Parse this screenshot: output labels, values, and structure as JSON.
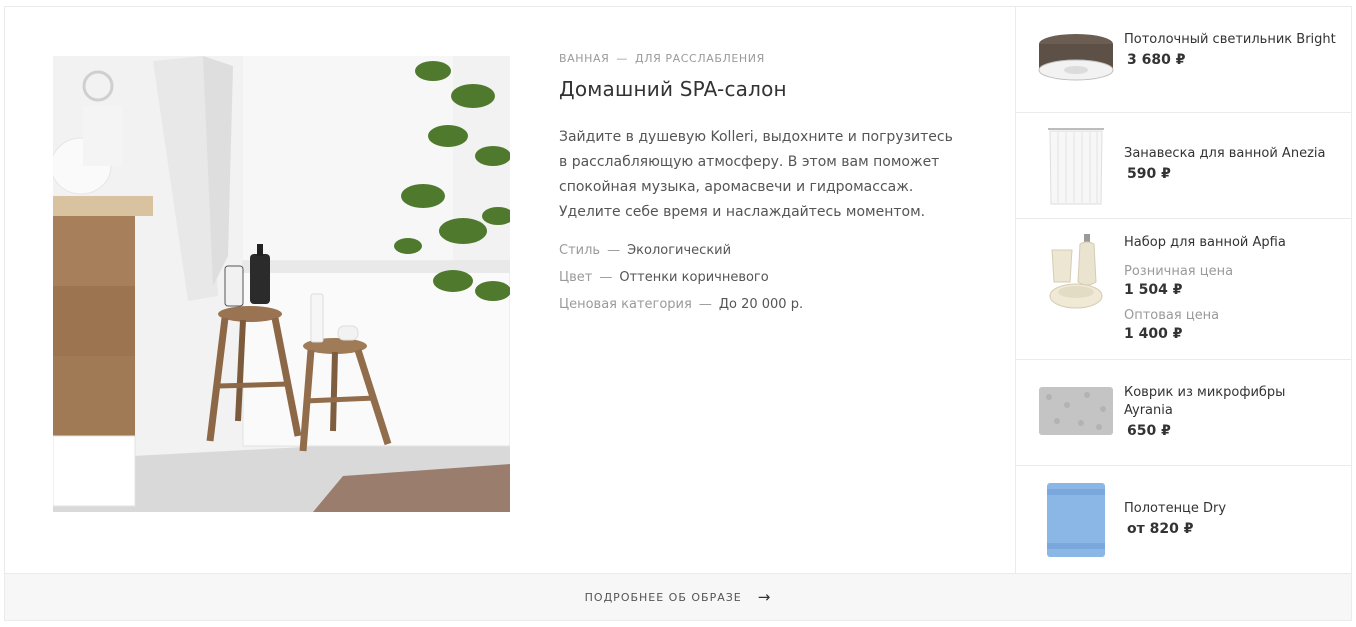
{
  "look": {
    "breadcrumbs": [
      "ВАННАЯ",
      "ДЛЯ РАССЛАБЛЕНИЯ"
    ],
    "separator": "—",
    "title": "Домашний SPA-салон",
    "description": "Зайдите в душевую Kolleri, выдохните и погрузитесь в расслабляющую атмосферу. В этом вам поможет спокойная музыка, аромасвечи и гидромассаж. Уделите себе время и наслаждайтесь моментом.",
    "properties": [
      {
        "label": "Стиль",
        "value": "Экологический"
      },
      {
        "label": "Цвет",
        "value": "Оттенки коричневого"
      },
      {
        "label": "Ценовая категория",
        "value": "До 20 000 р."
      }
    ]
  },
  "products": [
    {
      "name": "Потолочный светильник Bright",
      "price": "3 680 ₽",
      "icon": "ceiling-lamp-icon"
    },
    {
      "name": "Занавеска для ванной Anezia",
      "price": "590 ₽",
      "icon": "shower-curtain-icon"
    },
    {
      "name": "Набор для ванной Apfia",
      "retail_label": "Розничная цена",
      "retail_price": "1 504 ₽",
      "wholesale_label": "Оптовая цена",
      "wholesale_price": "1 400 ₽",
      "icon": "bath-set-icon"
    },
    {
      "name": "Коврик из микрофибры Ayrania",
      "price": "650 ₽",
      "icon": "bath-mat-icon"
    },
    {
      "name": "Полотенце Dry",
      "price": "от 820 ₽",
      "icon": "towel-icon"
    }
  ],
  "footer": {
    "more_label": "ПОДРОБНЕЕ ОБ ОБРАЗЕ",
    "arrow": "→"
  },
  "colors": {
    "border": "#ebebeb",
    "footer_bg": "#f7f7f7",
    "muted_text": "#9a9a9a",
    "text": "#333333"
  }
}
